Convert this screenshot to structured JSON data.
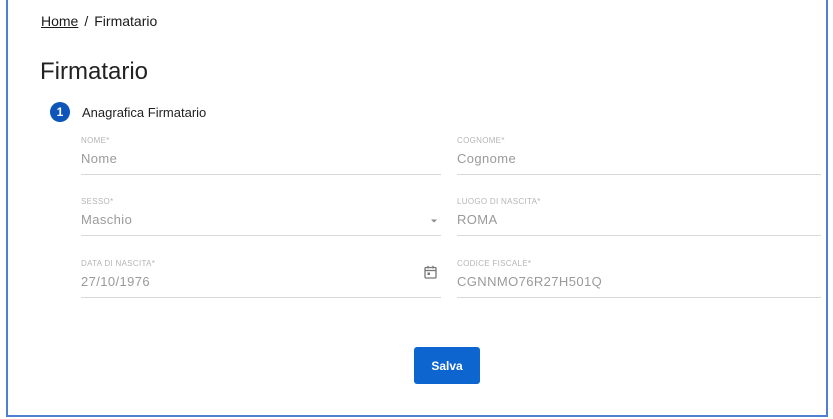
{
  "breadcrumb": {
    "home": "Home",
    "separator": "/",
    "current": "Firmatario"
  },
  "page": {
    "title": "Firmatario"
  },
  "step": {
    "number": "1",
    "label": "Anagrafica Firmatario"
  },
  "form": {
    "nome": {
      "label": "NOME*",
      "value": "Nome"
    },
    "cognome": {
      "label": "COGNOME*",
      "value": "Cognome"
    },
    "sesso": {
      "label": "SESSO*",
      "value": "Maschio"
    },
    "luogo": {
      "label": "LUOGO DI NASCITA*",
      "value": "ROMA"
    },
    "data": {
      "label": "DATA DI NASCITA*",
      "value": "27/10/1976"
    },
    "cf": {
      "label": "CODICE FISCALE*",
      "value": "CGNNMO76R27H501Q"
    }
  },
  "actions": {
    "save_label": "Salva"
  },
  "colors": {
    "accent": "#0d66d0",
    "frame": "#4f7fd3",
    "step_badge": "#0d55b8"
  },
  "icons": {
    "sesso": "chevron-down-icon",
    "data": "calendar-icon"
  }
}
